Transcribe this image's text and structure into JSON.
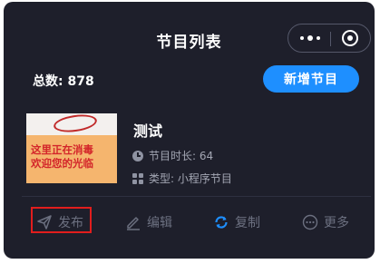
{
  "header": {
    "title": "节目列表",
    "menu_icon": "more-dots-icon",
    "close_icon": "target-icon"
  },
  "summary": {
    "total_label": "总数:",
    "total_value": "878",
    "new_button_label": "新增节目",
    "accent_color": "#1e8fff"
  },
  "program": {
    "title": "测试",
    "thumbnail_text_line1": "这里正在消毒",
    "thumbnail_text_line2": "欢迎您的光临",
    "duration_label": "节目时长: 64",
    "type_label": "类型: 小程序节目"
  },
  "actions": [
    {
      "label": "发布",
      "icon": "send-icon"
    },
    {
      "label": "编辑",
      "icon": "pencil-icon"
    },
    {
      "label": "复制",
      "icon": "refresh-icon"
    },
    {
      "label": "更多",
      "icon": "more-circle-icon"
    }
  ],
  "highlight_color": "#e11d1d"
}
